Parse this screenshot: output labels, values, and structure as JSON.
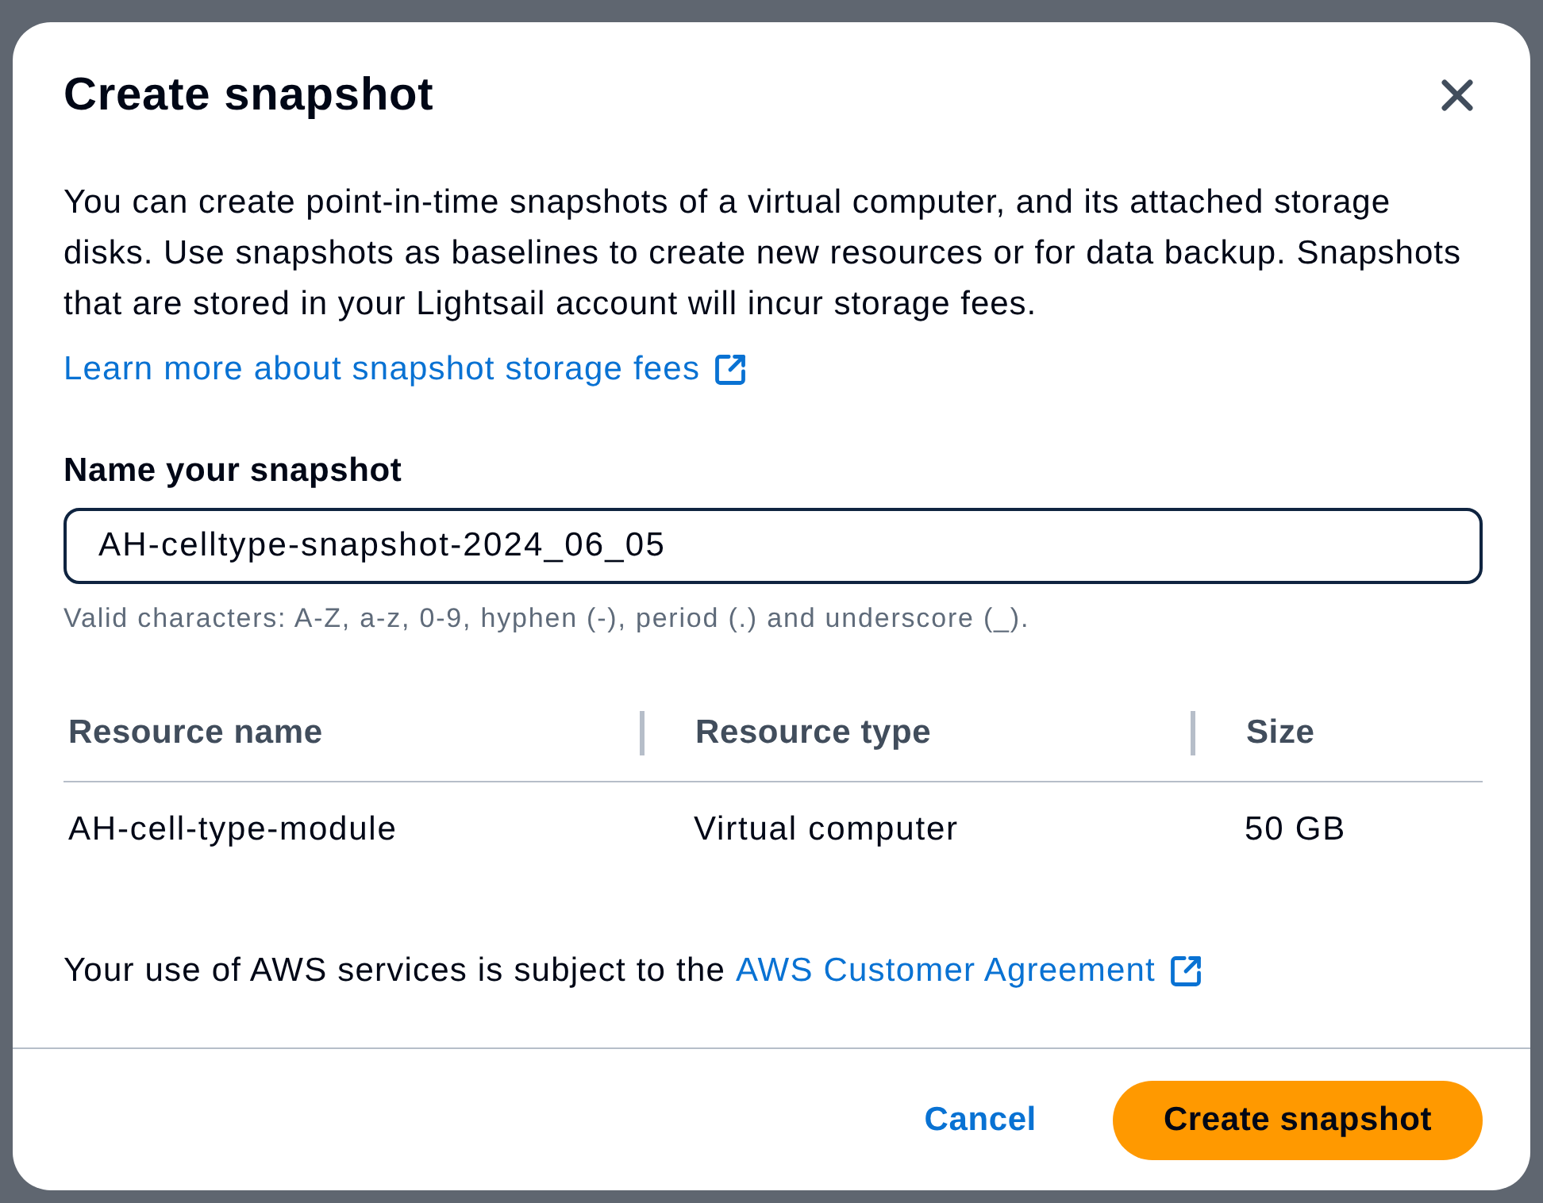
{
  "dialog": {
    "title": "Create snapshot",
    "description": "You can create point-in-time snapshots of a virtual computer, and its attached storage disks. Use snapshots as baselines to create new resources or for data backup. Snapshots that are stored in your Lightsail account will incur storage fees.",
    "learn_more_link": "Learn more about snapshot storage fees",
    "name_field": {
      "label": "Name your snapshot",
      "value": "AH-celltype-snapshot-2024_06_05",
      "focused": true,
      "hint": "Valid characters: A-Z, a-z, 0-9, hyphen (-), period (.) and underscore (_)."
    },
    "table": {
      "columns": [
        "Resource name",
        "Resource type",
        "Size"
      ],
      "rows": [
        [
          "AH-cell-type-module",
          "Virtual computer",
          "50 GB"
        ]
      ]
    },
    "agreement": {
      "text": "Your use of AWS services is subject to the",
      "link": "AWS Customer Agreement"
    },
    "buttons": [
      {
        "label": "Cancel",
        "kind": "link"
      },
      {
        "label": "Create snapshot",
        "kind": "primary"
      }
    ]
  }
}
